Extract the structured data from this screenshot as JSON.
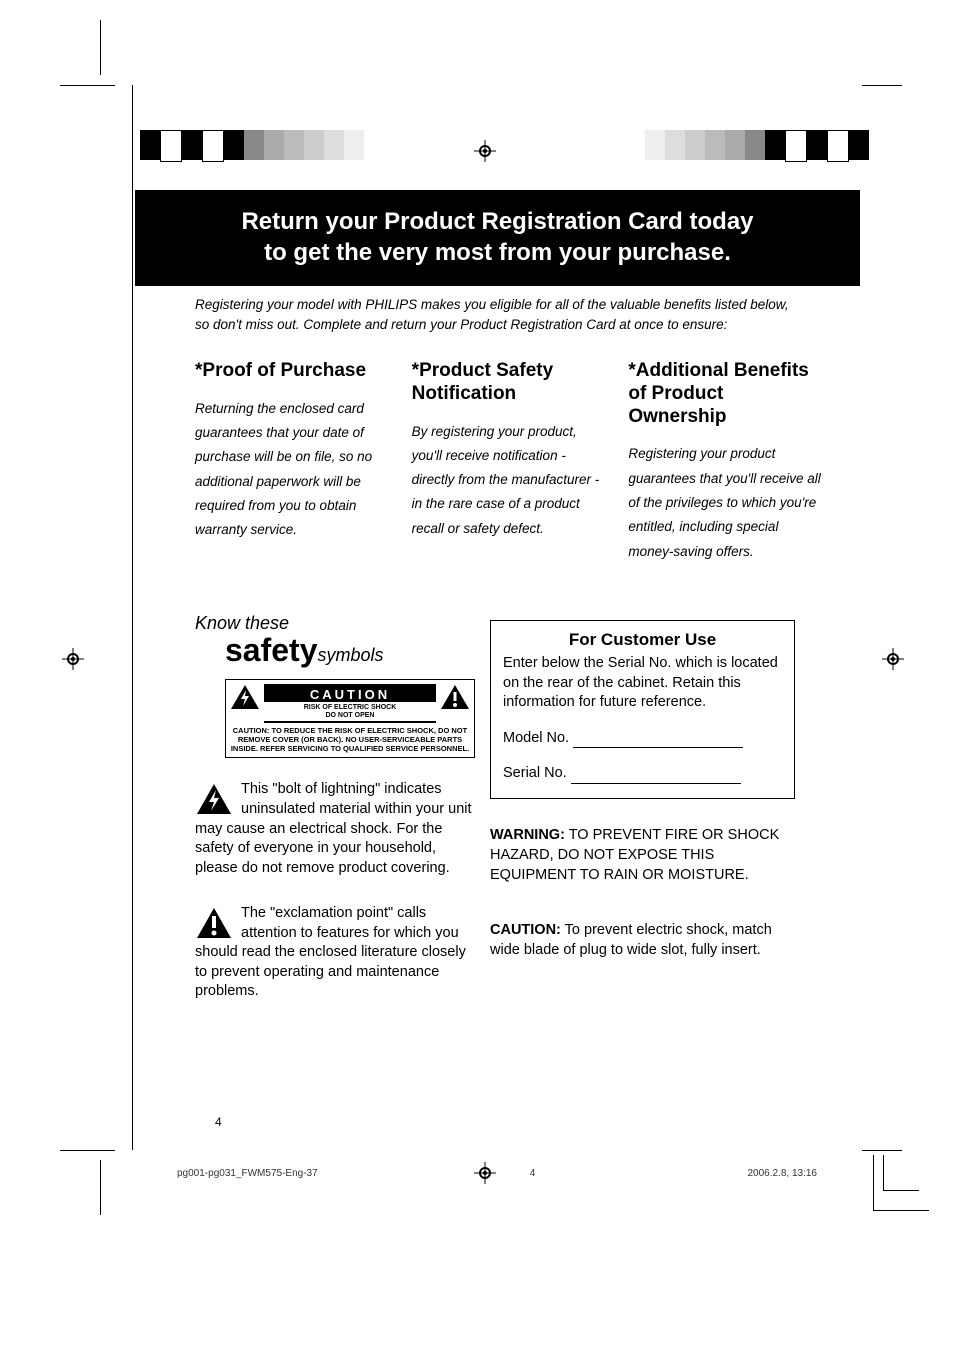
{
  "banner": {
    "line1": "Return your Product Registration Card today",
    "line2": "to get the very most from your purchase."
  },
  "intro": "Registering your model with PHILIPS makes you eligible for all of the valuable benefits listed below, so don't miss out. Complete and return your Product Registration Card at once to ensure:",
  "columns": {
    "proof": {
      "title": "*Proof of Purchase",
      "body": "Returning the enclosed card guarantees that your date of purchase will be on file, so no additional paperwork will be required from you to obtain warranty service."
    },
    "safety": {
      "title": "*Product Safety Notification",
      "body": "By registering your product, you'll receive notification - directly from the manufacturer - in the rare case of a product recall or safety defect."
    },
    "benefits": {
      "title": "*Additional Benefits of Product Ownership",
      "body": "Registering your product guarantees that you'll receive all of the privileges to which you're entitled, including special money-saving offers."
    }
  },
  "know": {
    "lead": "Know these",
    "big": "safety",
    "small": "symbols",
    "caution_word": "CAUTION",
    "caution_sub1": "RISK OF ELECTRIC SHOCK",
    "caution_sub2": "DO NOT OPEN",
    "caution_fine": "CAUTION: TO REDUCE THE RISK OF ELECTRIC SHOCK, DO NOT REMOVE COVER (OR BACK). NO USER-SERVICEABLE PARTS INSIDE. REFER SERVICING TO QUALIFIED SERVICE PERSONNEL.",
    "bolt_para": "This \"bolt of lightning\" indicates uninsulated material within your unit may cause an electrical shock. For the safety of everyone in your household, please do not remove product covering.",
    "excl_para": "The \"exclamation point\" calls attention to features for which you should read the enclosed literature closely to prevent operating and maintenance problems."
  },
  "customer": {
    "title": "For Customer Use",
    "body": "Enter below the Serial No. which is located on the rear of the cabinet. Retain this information for future reference.",
    "model_label": "Model No.",
    "serial_label": "Serial No."
  },
  "warning": {
    "lead": "WARNING:",
    "body": " TO PREVENT FIRE OR SHOCK HAZARD, DO NOT EXPOSE THIS EQUIPMENT TO RAIN OR MOISTURE."
  },
  "caution_text": {
    "lead": "CAUTION:",
    "body": " To prevent electric shock, match wide blade of plug to wide slot, fully insert."
  },
  "page_number": "4",
  "footer": {
    "file": "pg001-pg031_FWM575-Eng-37",
    "page": "4",
    "date": "2006.2.8, 13:16"
  },
  "colorbar_colors_left": [
    "#000",
    "#fff",
    "#000",
    "#fff",
    "#000",
    "#aaa",
    "#bbb",
    "#ccc",
    "#ddd",
    "#eee",
    "#fff",
    "#fff"
  ],
  "colorbar_colors_right": [
    "#fff",
    "#eee",
    "#ddd",
    "#ccc",
    "#bbb",
    "#aaa",
    "#000",
    "#fff",
    "#000",
    "#fff",
    "#000",
    "#fff"
  ]
}
